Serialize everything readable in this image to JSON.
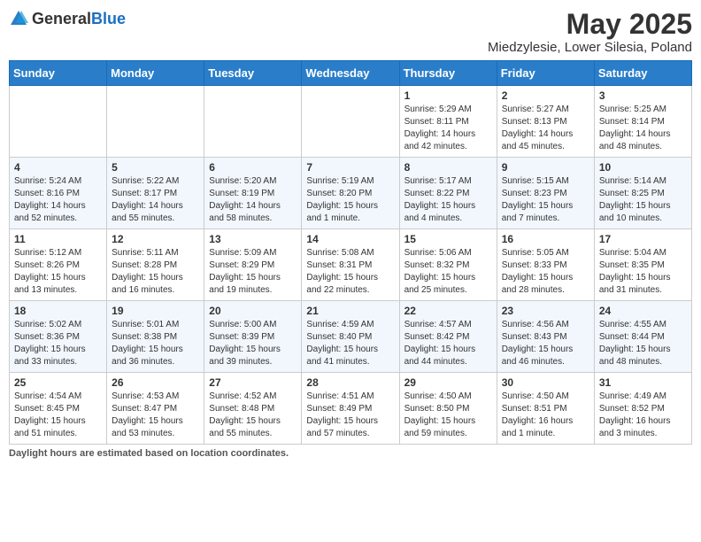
{
  "header": {
    "logo_general": "General",
    "logo_blue": "Blue",
    "title": "May 2025",
    "subtitle": "Miedzylesie, Lower Silesia, Poland"
  },
  "days_of_week": [
    "Sunday",
    "Monday",
    "Tuesday",
    "Wednesday",
    "Thursday",
    "Friday",
    "Saturday"
  ],
  "weeks": [
    [
      {
        "day": "",
        "detail": ""
      },
      {
        "day": "",
        "detail": ""
      },
      {
        "day": "",
        "detail": ""
      },
      {
        "day": "",
        "detail": ""
      },
      {
        "day": "1",
        "detail": "Sunrise: 5:29 AM\nSunset: 8:11 PM\nDaylight: 14 hours\nand 42 minutes."
      },
      {
        "day": "2",
        "detail": "Sunrise: 5:27 AM\nSunset: 8:13 PM\nDaylight: 14 hours\nand 45 minutes."
      },
      {
        "day": "3",
        "detail": "Sunrise: 5:25 AM\nSunset: 8:14 PM\nDaylight: 14 hours\nand 48 minutes."
      }
    ],
    [
      {
        "day": "4",
        "detail": "Sunrise: 5:24 AM\nSunset: 8:16 PM\nDaylight: 14 hours\nand 52 minutes."
      },
      {
        "day": "5",
        "detail": "Sunrise: 5:22 AM\nSunset: 8:17 PM\nDaylight: 14 hours\nand 55 minutes."
      },
      {
        "day": "6",
        "detail": "Sunrise: 5:20 AM\nSunset: 8:19 PM\nDaylight: 14 hours\nand 58 minutes."
      },
      {
        "day": "7",
        "detail": "Sunrise: 5:19 AM\nSunset: 8:20 PM\nDaylight: 15 hours\nand 1 minute."
      },
      {
        "day": "8",
        "detail": "Sunrise: 5:17 AM\nSunset: 8:22 PM\nDaylight: 15 hours\nand 4 minutes."
      },
      {
        "day": "9",
        "detail": "Sunrise: 5:15 AM\nSunset: 8:23 PM\nDaylight: 15 hours\nand 7 minutes."
      },
      {
        "day": "10",
        "detail": "Sunrise: 5:14 AM\nSunset: 8:25 PM\nDaylight: 15 hours\nand 10 minutes."
      }
    ],
    [
      {
        "day": "11",
        "detail": "Sunrise: 5:12 AM\nSunset: 8:26 PM\nDaylight: 15 hours\nand 13 minutes."
      },
      {
        "day": "12",
        "detail": "Sunrise: 5:11 AM\nSunset: 8:28 PM\nDaylight: 15 hours\nand 16 minutes."
      },
      {
        "day": "13",
        "detail": "Sunrise: 5:09 AM\nSunset: 8:29 PM\nDaylight: 15 hours\nand 19 minutes."
      },
      {
        "day": "14",
        "detail": "Sunrise: 5:08 AM\nSunset: 8:31 PM\nDaylight: 15 hours\nand 22 minutes."
      },
      {
        "day": "15",
        "detail": "Sunrise: 5:06 AM\nSunset: 8:32 PM\nDaylight: 15 hours\nand 25 minutes."
      },
      {
        "day": "16",
        "detail": "Sunrise: 5:05 AM\nSunset: 8:33 PM\nDaylight: 15 hours\nand 28 minutes."
      },
      {
        "day": "17",
        "detail": "Sunrise: 5:04 AM\nSunset: 8:35 PM\nDaylight: 15 hours\nand 31 minutes."
      }
    ],
    [
      {
        "day": "18",
        "detail": "Sunrise: 5:02 AM\nSunset: 8:36 PM\nDaylight: 15 hours\nand 33 minutes."
      },
      {
        "day": "19",
        "detail": "Sunrise: 5:01 AM\nSunset: 8:38 PM\nDaylight: 15 hours\nand 36 minutes."
      },
      {
        "day": "20",
        "detail": "Sunrise: 5:00 AM\nSunset: 8:39 PM\nDaylight: 15 hours\nand 39 minutes."
      },
      {
        "day": "21",
        "detail": "Sunrise: 4:59 AM\nSunset: 8:40 PM\nDaylight: 15 hours\nand 41 minutes."
      },
      {
        "day": "22",
        "detail": "Sunrise: 4:57 AM\nSunset: 8:42 PM\nDaylight: 15 hours\nand 44 minutes."
      },
      {
        "day": "23",
        "detail": "Sunrise: 4:56 AM\nSunset: 8:43 PM\nDaylight: 15 hours\nand 46 minutes."
      },
      {
        "day": "24",
        "detail": "Sunrise: 4:55 AM\nSunset: 8:44 PM\nDaylight: 15 hours\nand 48 minutes."
      }
    ],
    [
      {
        "day": "25",
        "detail": "Sunrise: 4:54 AM\nSunset: 8:45 PM\nDaylight: 15 hours\nand 51 minutes."
      },
      {
        "day": "26",
        "detail": "Sunrise: 4:53 AM\nSunset: 8:47 PM\nDaylight: 15 hours\nand 53 minutes."
      },
      {
        "day": "27",
        "detail": "Sunrise: 4:52 AM\nSunset: 8:48 PM\nDaylight: 15 hours\nand 55 minutes."
      },
      {
        "day": "28",
        "detail": "Sunrise: 4:51 AM\nSunset: 8:49 PM\nDaylight: 15 hours\nand 57 minutes."
      },
      {
        "day": "29",
        "detail": "Sunrise: 4:50 AM\nSunset: 8:50 PM\nDaylight: 15 hours\nand 59 minutes."
      },
      {
        "day": "30",
        "detail": "Sunrise: 4:50 AM\nSunset: 8:51 PM\nDaylight: 16 hours\nand 1 minute."
      },
      {
        "day": "31",
        "detail": "Sunrise: 4:49 AM\nSunset: 8:52 PM\nDaylight: 16 hours\nand 3 minutes."
      }
    ]
  ],
  "footer": {
    "label": "Daylight hours",
    "description": " are estimated based on location coordinates."
  },
  "colors": {
    "header_bg": "#2a7dc9",
    "accent": "#1a6fc4"
  }
}
